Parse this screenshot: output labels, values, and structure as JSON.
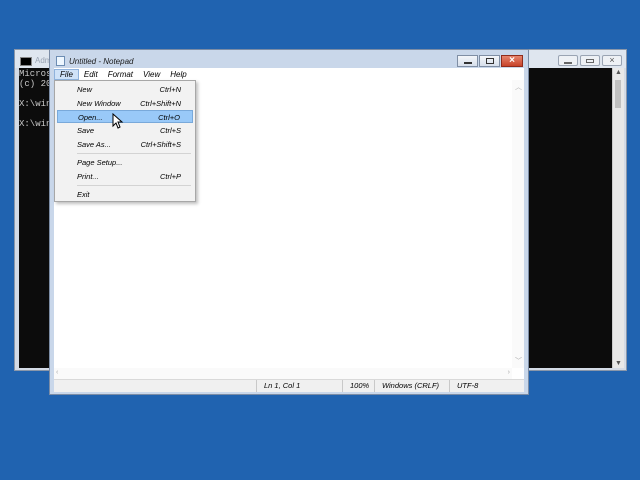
{
  "console": {
    "title": "Adm",
    "lines": [
      "Micros",
      "(c) 20",
      "",
      "X:\\win",
      "",
      "X:\\win"
    ]
  },
  "notepad": {
    "title": "Untitled - Notepad",
    "menu": [
      "File",
      "Edit",
      "Format",
      "View",
      "Help"
    ],
    "status": {
      "position": "Ln 1, Col 1",
      "zoom": "100%",
      "line_ending": "Windows (CRLF)",
      "encoding": "UTF-8"
    }
  },
  "file_menu": {
    "items": [
      {
        "label": "New",
        "shortcut": "Ctrl+N"
      },
      {
        "label": "New Window",
        "shortcut": "Ctrl+Shift+N"
      },
      {
        "label": "Open...",
        "shortcut": "Ctrl+O",
        "highlighted": true
      },
      {
        "label": "Save",
        "shortcut": "Ctrl+S"
      },
      {
        "label": "Save As...",
        "shortcut": "Ctrl+Shift+S"
      },
      {
        "label": "Page Setup...",
        "shortcut": ""
      },
      {
        "label": "Print...",
        "shortcut": "Ctrl+P"
      },
      {
        "label": "Exit",
        "shortcut": ""
      }
    ]
  },
  "colors": {
    "desktop": "#2063b0",
    "highlight": "#99c9f8",
    "close_button": "#c7432a"
  },
  "icons": {
    "console": "console-window-icon",
    "notepad": "notepad-icon",
    "cursor": "mouse-pointer-icon"
  }
}
